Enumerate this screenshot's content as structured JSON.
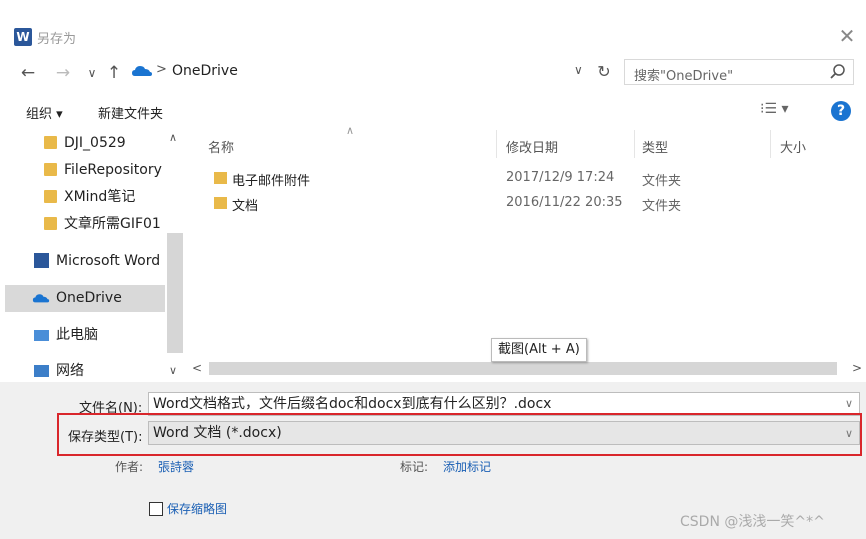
{
  "window": {
    "title": "另存为",
    "app_icon_letter": "W"
  },
  "nav": {
    "back": "←",
    "forward": "→",
    "recent": "∨",
    "up": "↑",
    "address_sep": ">",
    "address": "OneDrive",
    "refresh": "↻",
    "search_placeholder": "搜索\"OneDrive\""
  },
  "toolbar": {
    "organize": "组织 ▾",
    "new_folder": "新建文件夹",
    "view": "⁝☰ ▾",
    "help": "?"
  },
  "sidebar": {
    "items": [
      {
        "label": "DJI_0529",
        "icon": "folder-icon"
      },
      {
        "label": "FileRepository",
        "icon": "folder-icon"
      },
      {
        "label": "XMind笔记",
        "icon": "folder-icon"
      },
      {
        "label": "文章所需GIF01",
        "icon": "folder-icon"
      },
      {
        "label": "Microsoft Word",
        "icon": "word-icon"
      },
      {
        "label": "OneDrive",
        "icon": "onedrive-icon",
        "selected": true
      },
      {
        "label": "此电脑",
        "icon": "pc-icon"
      },
      {
        "label": "网络",
        "icon": "network-icon"
      }
    ]
  },
  "columns": [
    "名称",
    "修改日期",
    "类型",
    "大小"
  ],
  "files": [
    {
      "name": "电子邮件附件",
      "date": "2017/12/9 17:24",
      "type": "文件夹"
    },
    {
      "name": "文档",
      "date": "2016/11/22 20:35",
      "type": "文件夹"
    }
  ],
  "tooltip": "截图(Alt + A)",
  "form": {
    "filename_label": "文件名(N):",
    "filename_value": "Word文档格式，文件后缀名doc和docx到底有什么区别？.docx",
    "type_label": "保存类型(T):",
    "type_value": "Word 文档 (*.docx)",
    "author_label": "作者:",
    "author_value": "張詩蓉",
    "tags_label": "标记:",
    "tags_value": "添加标记",
    "thumbnail_label": "保存缩略图"
  },
  "watermark": "CSDN @浅浅一笑^*^",
  "colors": {
    "accent": "#1a74d1",
    "highlight": "#d9262b",
    "folder": "#e9b949"
  }
}
